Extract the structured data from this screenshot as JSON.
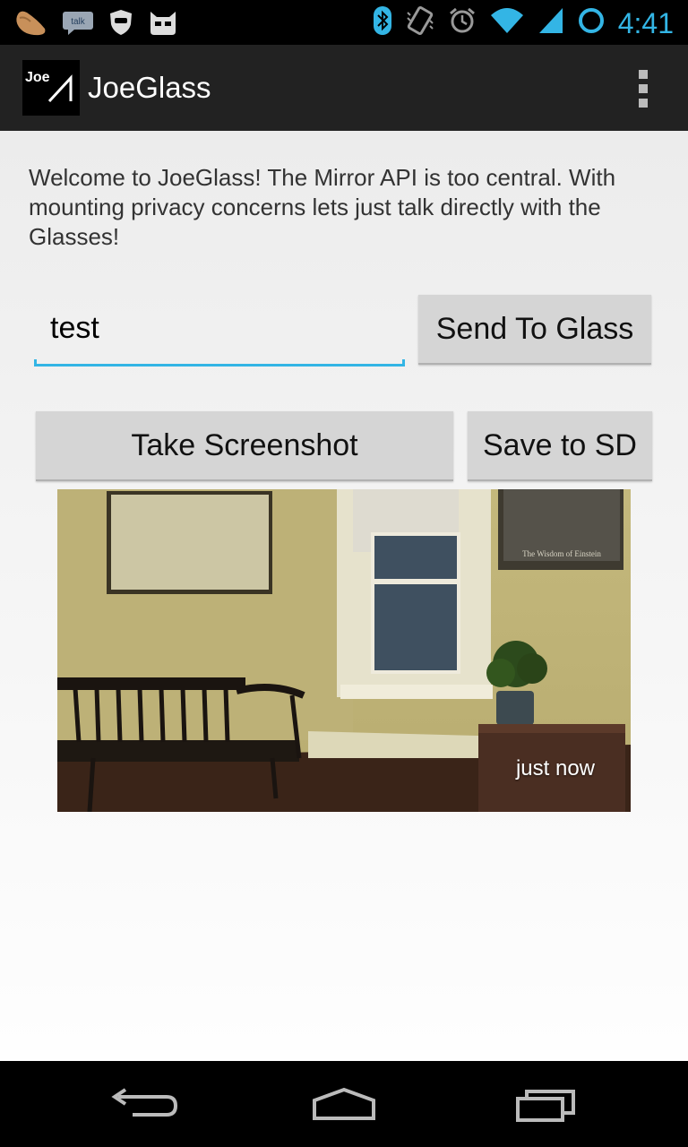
{
  "status_bar": {
    "time": "4:41",
    "notification_icons": [
      "bread-icon",
      "talk-icon",
      "shield-icon",
      "cat-icon"
    ],
    "system_icons": [
      "bluetooth-icon",
      "vibrate-icon",
      "alarm-icon",
      "wifi-icon",
      "signal-icon",
      "sync-icon"
    ],
    "talk_badge_text": "talk"
  },
  "action_bar": {
    "title": "JoeGlass",
    "app_icon_text": "Joe"
  },
  "main": {
    "welcome_text": "Welcome to JoeGlass! The Mirror API is too central. With mounting privacy concerns lets just talk directly with the Glasses!",
    "message_input_value": "test",
    "send_button_label": "Send To Glass",
    "screenshot_button_label": "Take Screenshot",
    "save_button_label": "Save to SD",
    "photo_caption": "just now",
    "poster_caption": "The Wisdom of Einstein"
  },
  "colors": {
    "accent": "#33b5e5",
    "action_bar": "#222222",
    "button": "#d5d5d5",
    "background": "#ececec"
  }
}
